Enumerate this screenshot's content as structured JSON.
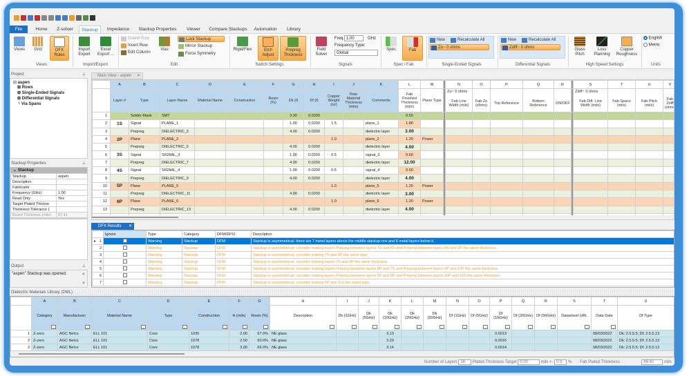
{
  "quick_access": [
    "new-icon",
    "open-icon",
    "save-icon",
    "save-as-icon",
    "undo-icon",
    "redo-icon",
    "cut-icon",
    "copy-icon",
    "paste-icon",
    "print-icon",
    "settings-icon",
    "help-icon"
  ],
  "tabs": [
    {
      "label": "File"
    },
    {
      "label": "Home"
    },
    {
      "label": "Z-solver"
    },
    {
      "label": "Stackup",
      "active": true
    },
    {
      "label": "Impedance"
    },
    {
      "label": "Stackup Properties"
    },
    {
      "label": "Viewer"
    },
    {
      "label": "Compare Stackups"
    },
    {
      "label": "Automation"
    },
    {
      "label": "Library"
    }
  ],
  "ribbon": {
    "views": {
      "label": "Views",
      "views": "Views",
      "grid": "Grid",
      "dfx": "DFX Rules"
    },
    "import_export": {
      "label": "Import/Export",
      "import": "Import Export",
      "excel": "Excel Export ..."
    },
    "edit": {
      "label": "Edit",
      "delete_row": "Delete Row",
      "insert_row": "Insert Row",
      "edit_column": "Edit Column",
      "vias": "Vias",
      "lock": "Lock Stackup",
      "mirror": "Mirror Stackup",
      "force": "Force Symmetry"
    },
    "switch": {
      "label": "Switch Settings",
      "rigid": "Rigid/Flex",
      "etch": "Etch Adjust",
      "prepreg": "Prepreg Thickness"
    },
    "signals": {
      "label": "Signals",
      "field_solver": "Field Solver",
      "freq_label": "Freq.",
      "freq_value": "1.00",
      "freq_unit": "GHz",
      "freq_type_label": "Frequency Type:",
      "freq_type_value": "Global"
    },
    "specfab": {
      "label": "Spec / Fab",
      "spec": "Spec",
      "fab": "Fab"
    },
    "single": {
      "label": "Single-Ended Signals",
      "new": "New",
      "recalc": "Recalculate All",
      "value": "Zo~ 0 ohms"
    },
    "diff": {
      "label": "Differential Signals",
      "new": "New",
      "recalc": "Recalculate All",
      "value": "Zdiff~ 0 ohms"
    },
    "highspeed": {
      "label": "High Speed Settings",
      "glass": "Glass Pitch",
      "loss": "Loss Planning",
      "copper": "Copper Roughness"
    },
    "units": {
      "label": "Units",
      "english": "English",
      "metric": "Metric",
      "selected": "English"
    }
  },
  "project": {
    "title": "Project",
    "root": "aspen",
    "items": [
      "Rows",
      "Single-Ended Signals",
      "Differential Signals",
      "Via Spans"
    ]
  },
  "stackup_properties": {
    "title": "Stackup Properties",
    "section": "Stackup",
    "rows": [
      [
        "Stackup",
        "aspen"
      ],
      [
        "Description",
        ""
      ],
      [
        "Fabricator",
        ""
      ],
      [
        "Frequency (GHz)",
        "1.00"
      ],
      [
        "Read Only",
        "Yes"
      ],
      [
        "Target Plated Thickne",
        ""
      ],
      [
        "Thickness Tolerance (",
        ""
      ],
      [
        "Board Thickness (mils)",
        "87.41"
      ]
    ]
  },
  "output": {
    "title": "Output",
    "text": "\"aspen\" Stackup was opened."
  },
  "main_view": {
    "tab": "Main View - aspen",
    "letters": [
      "A",
      "B",
      "C",
      "D",
      "E",
      "F",
      "G",
      "H",
      "I",
      "J",
      "K",
      "L",
      "M",
      "N",
      "O",
      "P",
      "Q",
      "R",
      "S",
      "T",
      "U",
      "V"
    ],
    "zo_label": "Zo~ 0 ohms",
    "zdiff_label": "Zdiff~ 0 ohms",
    "headers": [
      "Layer #",
      "Type",
      "Layer Name",
      "Material Name",
      "Construction",
      "Resin (%)",
      "Dk (f)",
      "Df (f)",
      "Copper Weight (oz)",
      "Raw Material Thickness (mils)",
      "Comments",
      "Fab Finished Thickness (mils)",
      "Plane Type",
      "Fab Line Width (mils)",
      "Fab Zo (ohms)",
      "Top Reference",
      "Bottom Reference",
      "ON/OFF",
      "Fab Diff. Line Width (mils)",
      "Fab Space (mils)",
      "Fab Pitch (mils)",
      "Fab Zdiff (ohms)"
    ],
    "rows": [
      {
        "n": "1",
        "kind": "sm",
        "cells": [
          "",
          "Solder Mask",
          "SMT",
          "",
          "",
          "",
          "3.30",
          "0.0200",
          "",
          "",
          "",
          "0.50",
          ""
        ]
      },
      {
        "n": "2",
        "kind": "sig",
        "cells": [
          "1S",
          "Signal",
          "PLANE_1",
          "",
          "",
          "",
          "1.00",
          "0.0200",
          "1.5",
          "",
          "plane_1",
          "1.80",
          ""
        ]
      },
      {
        "n": "3",
        "kind": "pre",
        "cells": [
          "",
          "Prepreg",
          "DIELECTRIC_3",
          "",
          "",
          "",
          "4.00",
          "0.0200",
          "",
          "",
          "dielectric layer",
          "3.00",
          ""
        ]
      },
      {
        "n": "4",
        "kind": "pla",
        "cells": [
          "2P",
          "Plane",
          "PLANE_2",
          "",
          "",
          "",
          "",
          "",
          "1.0",
          "",
          "plane_2",
          "1.20",
          "Power"
        ]
      },
      {
        "n": "5",
        "kind": "pre",
        "cells": [
          "",
          "Prepreg",
          "DIELECTRIC_5",
          "",
          "",
          "",
          "4.00",
          "0.0200",
          "",
          "",
          "dielectric layer",
          "4.00",
          ""
        ]
      },
      {
        "n": "6",
        "kind": "sig",
        "cells": [
          "3S",
          "Signal",
          "SIGNAL_3",
          "",
          "",
          "",
          "1.00",
          "0.0200",
          "0.5",
          "",
          "signal_3",
          "0.60",
          ""
        ]
      },
      {
        "n": "7",
        "kind": "pre",
        "cells": [
          "",
          "Prepreg",
          "DIELECTRIC_7",
          "",
          "",
          "",
          "4.00",
          "0.0200",
          "",
          "",
          "dielectric layer",
          "12.00",
          ""
        ]
      },
      {
        "n": "8",
        "kind": "sig",
        "cells": [
          "4S",
          "Signal",
          "SIGNAL_4",
          "",
          "",
          "",
          "1.00",
          "0.0200",
          "0.5",
          "",
          "signal_4",
          "0.60",
          ""
        ]
      },
      {
        "n": "9",
        "kind": "pre",
        "cells": [
          "",
          "Prepreg",
          "DIELECTRIC_9",
          "",
          "",
          "",
          "4.00",
          "0.0200",
          "",
          "",
          "dielectric layer",
          "4.00",
          ""
        ]
      },
      {
        "n": "10",
        "kind": "pla",
        "cells": [
          "5P",
          "Plane",
          "PLANE_5",
          "",
          "",
          "",
          "",
          "",
          "1.0",
          "",
          "plane_5",
          "1.20",
          "Power"
        ]
      },
      {
        "n": "11",
        "kind": "pre",
        "cells": [
          "",
          "Prepreg",
          "DIELECTRIC_11",
          "",
          "",
          "",
          "4.00",
          "0.0200",
          "",
          "",
          "dielectric layer",
          "3.00",
          ""
        ]
      },
      {
        "n": "12",
        "kind": "pla",
        "cells": [
          "6P",
          "Plane",
          "PLANE_6",
          "",
          "",
          "",
          "",
          "",
          "1.0",
          "",
          "plane_6",
          "1.20",
          "Power"
        ]
      },
      {
        "n": "13",
        "kind": "pre",
        "cells": [
          "",
          "Prepreg",
          "DIELECTRIC_13",
          "",
          "",
          "",
          "4.00",
          "0.0200",
          "",
          "",
          "dielectric layer",
          "4.00",
          ""
        ]
      }
    ]
  },
  "dfx": {
    "tab": "DFX Results",
    "headers": [
      "Ignore",
      "Type",
      "Category",
      "DFM/DFSI",
      "Description"
    ],
    "rows": [
      {
        "n": "1",
        "type": "Warning",
        "category": "Stackup",
        "dfm": "DFM",
        "desc": "Stackup is asymmetrical: there are 7 metal layers above the middle stackup row and 8 metal layers below it.",
        "selected": true
      },
      {
        "n": "2",
        "type": "Warning",
        "category": "Stackup",
        "dfm": "DFM",
        "desc": "Stackup is asymmetrical: consider making layers Prepreg between layers 7S and 8S and Prepreg between layers 8S and 9P the same thickness."
      },
      {
        "n": "3",
        "type": "Warning",
        "category": "Stackup",
        "dfm": "DFM",
        "desc": "Stackup is asymmetrical: consider making 7S and 9P the same type."
      },
      {
        "n": "4",
        "type": "Warning",
        "category": "Stackup",
        "dfm": "DFM",
        "desc": "Stackup is asymmetrical: consider making layers 7S and 9P the same thickness."
      },
      {
        "n": "5",
        "type": "Warning",
        "category": "Stackup",
        "dfm": "DFM",
        "desc": "Stackup is asymmetrical: consider making layers Prepreg between layers 6P and 7S and Prepreg between layers 9P and 10P the same thickness."
      },
      {
        "n": "6",
        "type": "Warning",
        "category": "Stackup",
        "dfm": "DFM",
        "desc": "Stackup is asymmetrical: consider making layers Prepreg between layers 5P and 6P and Prepreg between layers 10P and 11S the same thickness."
      },
      {
        "n": "7",
        "type": "Warning",
        "category": "Stackup",
        "dfm": "DFM",
        "desc": "Stackup is asymmetrical: consider making 5P and 11S the same type."
      }
    ]
  },
  "dml": {
    "title": "Dielectric Materials Library (DML)",
    "letters": [
      "A",
      "B",
      "C",
      "D",
      "E",
      "F",
      "G",
      "H",
      "I",
      "J",
      "K",
      "L",
      "M",
      "N",
      "O",
      "P",
      "Q",
      "R",
      "S",
      "T",
      "U"
    ],
    "headers": [
      "Category",
      "Manufacturer",
      "Material Name",
      "Type",
      "Construction",
      "H (mils)",
      "Resin (%)",
      "Description",
      "Dk (1GHz)",
      "Dk (5GHz)",
      "Dk (10GHz)",
      "Dk (20GHz)",
      "Dk (50GHz)",
      "Df (1GHz)",
      "Df (5GHz)",
      "Df (10GHz)",
      "Df (20GHz)",
      "Df (50GHz)",
      "Datasheet URL",
      "Data Date",
      "Df Type"
    ],
    "rows": [
      {
        "n": "1",
        "cells": [
          "Z-zero",
          "AGC Nelco",
          "ELL 101",
          "Core",
          "1035",
          "2.00",
          "67.0%",
          "NE glass",
          "",
          "",
          "3.13",
          "",
          "",
          "",
          "",
          "0.0013",
          "",
          "",
          "",
          "08/03/2022",
          "Dk: 2.5.5.5; Df: 2.5.5.13"
        ]
      },
      {
        "n": "2",
        "cells": [
          "Z-zero",
          "AGC Nelco",
          "ELL 101",
          "Core",
          "1078",
          "2.50",
          "60.0%",
          "NE glass",
          "",
          "",
          "3.20",
          "",
          "",
          "",
          "",
          "0.0015",
          "",
          "",
          "",
          "08/03/2022",
          "Dk: 2.5.5.5; Df: 2.5.5.13"
        ]
      },
      {
        "n": "3",
        "cells": [
          "Z-zero",
          "AGC Nelco",
          "ELL 101",
          "Core",
          "1078",
          "3.00",
          "66.0%",
          "NE glass",
          "",
          "",
          "3.14",
          "",
          "",
          "",
          "",
          "0.0014",
          "",
          "",
          "",
          "08/03/2022",
          "Dk: 2.5.5.5; Df: 2.5.5.13"
        ]
      }
    ]
  },
  "status": {
    "layers_label": "Number of Layers",
    "layers": "16",
    "plated_label": "Plated Thickness Target",
    "plated": "0.00",
    "unit": "mils",
    "pm": "+-",
    "tol": "0.0",
    "pct": "%",
    "fab_label": "Fab Plated Thickness",
    "fab": "86.41",
    "fab_unit": "mils"
  },
  "colors": {
    "accent": "#1e6fc8",
    "selected_row": "#0078d7",
    "warning_text": "#f0a030",
    "solder_mask": "#c4d79b",
    "prepreg": "#ebf1de",
    "plane": "#fcd5b4",
    "header": "#bdd7ee",
    "dml_row": "#c9e6f0"
  }
}
